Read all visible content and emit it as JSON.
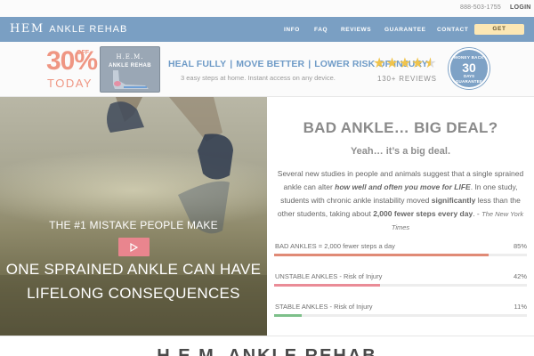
{
  "topbar": {
    "phone": "888-503-1755",
    "login": "LOGIN"
  },
  "nav": {
    "logo_main": "HEM",
    "logo_sub": "ANKLE REHAB",
    "links": [
      "INFO",
      "FAQ",
      "REVIEWS",
      "GUARANTEE",
      "CONTACT"
    ],
    "cta": "GET"
  },
  "promo": {
    "percent": "30%",
    "off": "OFF",
    "today": "TODAY",
    "product_title": "H.E.M.",
    "product_sub": "ANKLE REHAB",
    "tagline": [
      "HEAL FULLY",
      "MOVE BETTER",
      "LOWER RISK OF INJURY"
    ],
    "tagline_sep": "|",
    "tagline_sub": "3 easy steps at home. Instant access on any device.",
    "rating": 4.5,
    "reviews": "130+ REVIEWS",
    "seal_top": "MONEY BACK",
    "seal_num": "30",
    "seal_days": "DAYS",
    "seal_bottom": "GUARANTEE"
  },
  "hero": {
    "title_line1": "ONE SPRAINED ANKLE CAN HAVE",
    "title_line2": "LIFELONG CONSEQUENCES",
    "subtitle": "THE #1 MISTAKE PEOPLE MAKE",
    "play_icon": "play-icon"
  },
  "panel": {
    "heading": "BAD ANKLE… BIG DEAL?",
    "subheading": "Yeah… it’s a big deal.",
    "p1": "Several new studies in people and animals suggest that a single sprained ankle can alter ",
    "p1_em": "how well and often you move for LIFE",
    "p1_end": ". In one study, students with chronic ankle instability moved ",
    "p1_b": "significantly",
    "p1_mid": " less than the other students, taking about ",
    "p1_b2": "2,000 fewer steps every day",
    "p1_tail": ".  - ",
    "source": "The New York Times",
    "stats": [
      {
        "label": "BAD ANKLES = 2,000 fewer steps a day",
        "pct": "85%",
        "value": 0.85,
        "color": "#e08a76"
      },
      {
        "label": "UNSTABLE ANKLES - Risk of Injury",
        "pct": "42%",
        "value": 0.42,
        "color": "#ea8c97"
      },
      {
        "label": "STABLE ANKLES - Risk of Injury",
        "pct": "11%",
        "value": 0.11,
        "color": "#7dc08a"
      }
    ]
  },
  "bottom": {
    "title": "H.E.M. ANKLE REHAB"
  }
}
